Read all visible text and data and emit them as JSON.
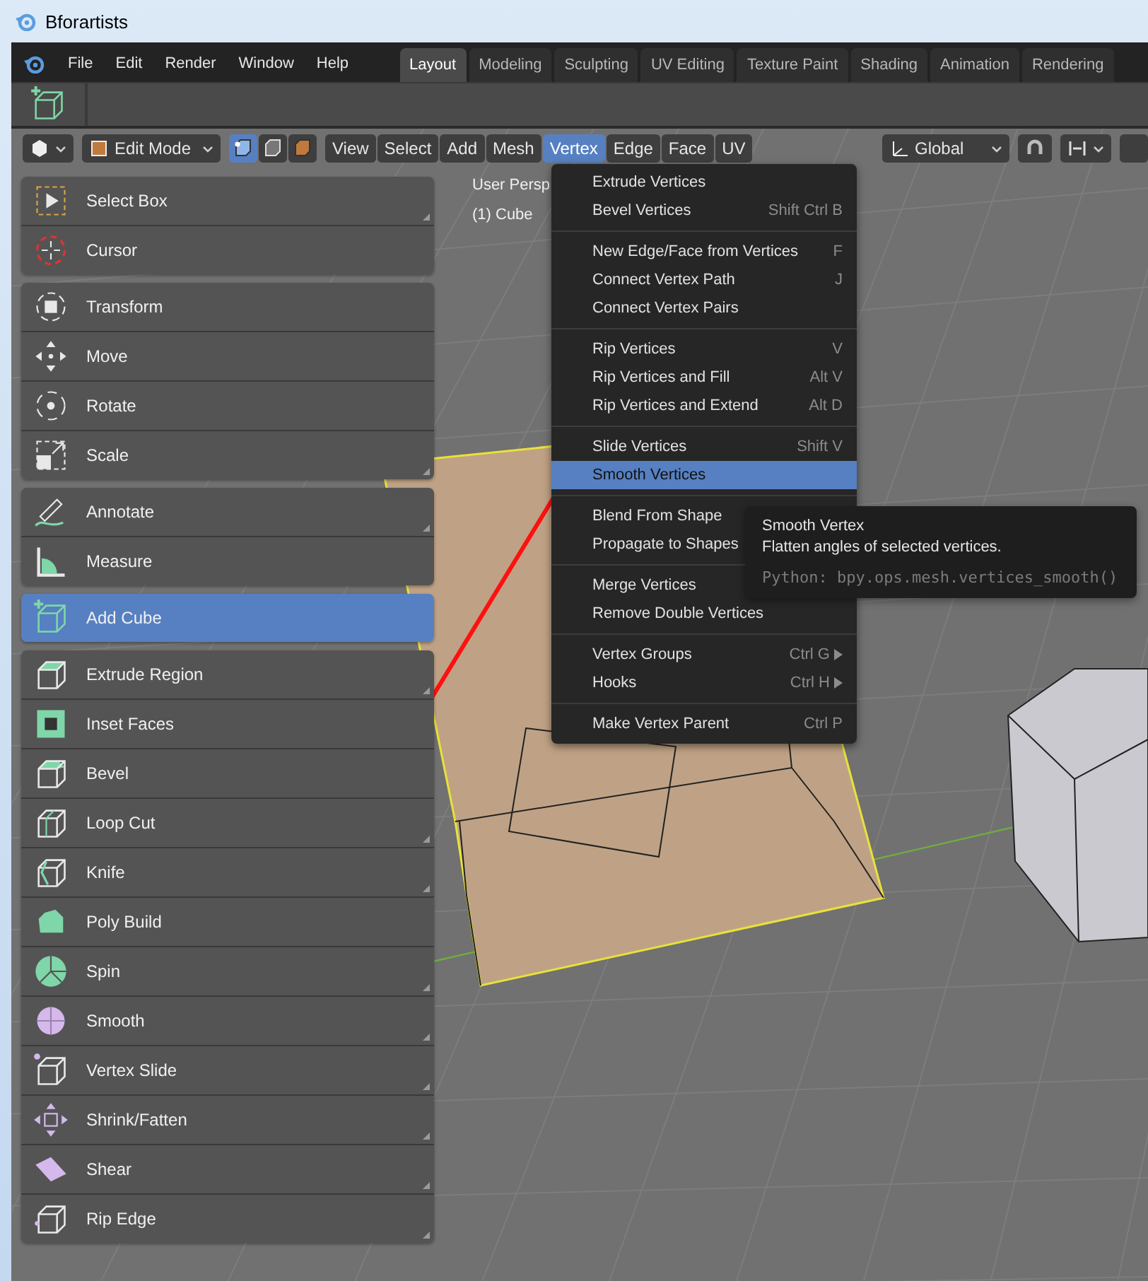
{
  "window": {
    "title": "Bforartists"
  },
  "menu_bar": [
    "File",
    "Edit",
    "Render",
    "Window",
    "Help"
  ],
  "workspace_tabs": [
    {
      "label": "Layout",
      "selected": true
    },
    {
      "label": "Modeling",
      "selected": false
    },
    {
      "label": "Sculpting",
      "selected": false
    },
    {
      "label": "UV Editing",
      "selected": false
    },
    {
      "label": "Texture Paint",
      "selected": false
    },
    {
      "label": "Shading",
      "selected": false
    },
    {
      "label": "Animation",
      "selected": false
    },
    {
      "label": "Rendering",
      "selected": false
    }
  ],
  "viewport_header": {
    "mode": "Edit Mode",
    "select_modes": [
      {
        "kind": "vertex",
        "selected": true
      },
      {
        "kind": "edge",
        "selected": false
      },
      {
        "kind": "face",
        "selected": false
      }
    ],
    "menus": [
      {
        "label": "View",
        "selected": false
      },
      {
        "label": "Select",
        "selected": false
      },
      {
        "label": "Add",
        "selected": false
      },
      {
        "label": "Mesh",
        "selected": false
      },
      {
        "label": "Vertex",
        "selected": true
      },
      {
        "label": "Edge",
        "selected": false
      },
      {
        "label": "Face",
        "selected": false
      },
      {
        "label": "UV",
        "selected": false
      }
    ],
    "orientation": "Global"
  },
  "viewport": {
    "view_name": "User Persp",
    "object_name": "(1) Cube"
  },
  "tool_groups": [
    {
      "tools": [
        {
          "label": "Select Box",
          "selected": false,
          "submenu": true
        },
        {
          "label": "Cursor",
          "selected": false,
          "submenu": false
        }
      ]
    },
    {
      "tools": [
        {
          "label": "Transform",
          "selected": false,
          "submenu": false
        },
        {
          "label": "Move",
          "selected": false,
          "submenu": false
        },
        {
          "label": "Rotate",
          "selected": false,
          "submenu": false
        },
        {
          "label": "Scale",
          "selected": false,
          "submenu": true
        }
      ]
    },
    {
      "tools": [
        {
          "label": "Annotate",
          "selected": false,
          "submenu": true
        },
        {
          "label": "Measure",
          "selected": false,
          "submenu": false
        }
      ]
    },
    {
      "tools": [
        {
          "label": "Add Cube",
          "selected": true,
          "submenu": false
        }
      ]
    },
    {
      "tools": [
        {
          "label": "Extrude Region",
          "selected": false,
          "submenu": true
        },
        {
          "label": "Inset Faces",
          "selected": false,
          "submenu": false
        },
        {
          "label": "Bevel",
          "selected": false,
          "submenu": false
        },
        {
          "label": "Loop Cut",
          "selected": false,
          "submenu": true
        },
        {
          "label": "Knife",
          "selected": false,
          "submenu": true
        },
        {
          "label": "Poly Build",
          "selected": false,
          "submenu": false
        },
        {
          "label": "Spin",
          "selected": false,
          "submenu": true
        },
        {
          "label": "Smooth",
          "selected": false,
          "submenu": true
        },
        {
          "label": "Vertex Slide",
          "selected": false,
          "submenu": true
        },
        {
          "label": "Shrink/Fatten",
          "selected": false,
          "submenu": true
        },
        {
          "label": "Shear",
          "selected": false,
          "submenu": true
        },
        {
          "label": "Rip Edge",
          "selected": false,
          "submenu": true
        }
      ]
    }
  ],
  "vertex_menu": {
    "sections": [
      {
        "items": [
          {
            "label": "Extrude Vertices",
            "selected": false,
            "submenu": false
          },
          {
            "label": "Bevel Vertices",
            "shortcut": "Shift Ctrl B",
            "selected": false,
            "submenu": false
          }
        ]
      },
      {
        "items": [
          {
            "label": "New Edge/Face from Vertices",
            "shortcut": "F",
            "selected": false,
            "submenu": false
          },
          {
            "label": "Connect Vertex Path",
            "shortcut": "J",
            "selected": false,
            "submenu": false
          },
          {
            "label": "Connect Vertex Pairs",
            "selected": false,
            "submenu": false
          }
        ]
      },
      {
        "items": [
          {
            "label": "Rip Vertices",
            "shortcut": "V",
            "selected": false,
            "submenu": false
          },
          {
            "label": "Rip Vertices and Fill",
            "shortcut": "Alt V",
            "selected": false,
            "submenu": false
          },
          {
            "label": "Rip Vertices and Extend",
            "shortcut": "Alt D",
            "selected": false,
            "submenu": false
          }
        ]
      },
      {
        "items": [
          {
            "label": "Slide Vertices",
            "shortcut": "Shift V",
            "selected": false,
            "submenu": false
          },
          {
            "label": "Smooth Vertices",
            "selected": true,
            "submenu": false
          }
        ]
      },
      {
        "items": [
          {
            "label": "Blend From Shape",
            "selected": false,
            "submenu": false
          },
          {
            "label": "Propagate to Shapes",
            "selected": false,
            "submenu": false
          }
        ]
      },
      {
        "items": [
          {
            "label": "Merge Vertices",
            "selected": false,
            "submenu": false
          },
          {
            "label": "Remove Double Vertices",
            "selected": false,
            "submenu": false
          }
        ]
      },
      {
        "items": [
          {
            "label": "Vertex Groups",
            "shortcut": "Ctrl G",
            "selected": false,
            "submenu": true
          },
          {
            "label": "Hooks",
            "shortcut": "Ctrl H",
            "selected": false,
            "submenu": true
          }
        ]
      },
      {
        "items": [
          {
            "label": "Make Vertex Parent",
            "shortcut": "Ctrl P",
            "selected": false,
            "submenu": false
          }
        ]
      }
    ]
  },
  "tooltip": {
    "title": "Smooth Vertex",
    "description": "Flatten angles of selected vertices.",
    "python": "Python: bpy.ops.mesh.vertices_smooth()"
  }
}
